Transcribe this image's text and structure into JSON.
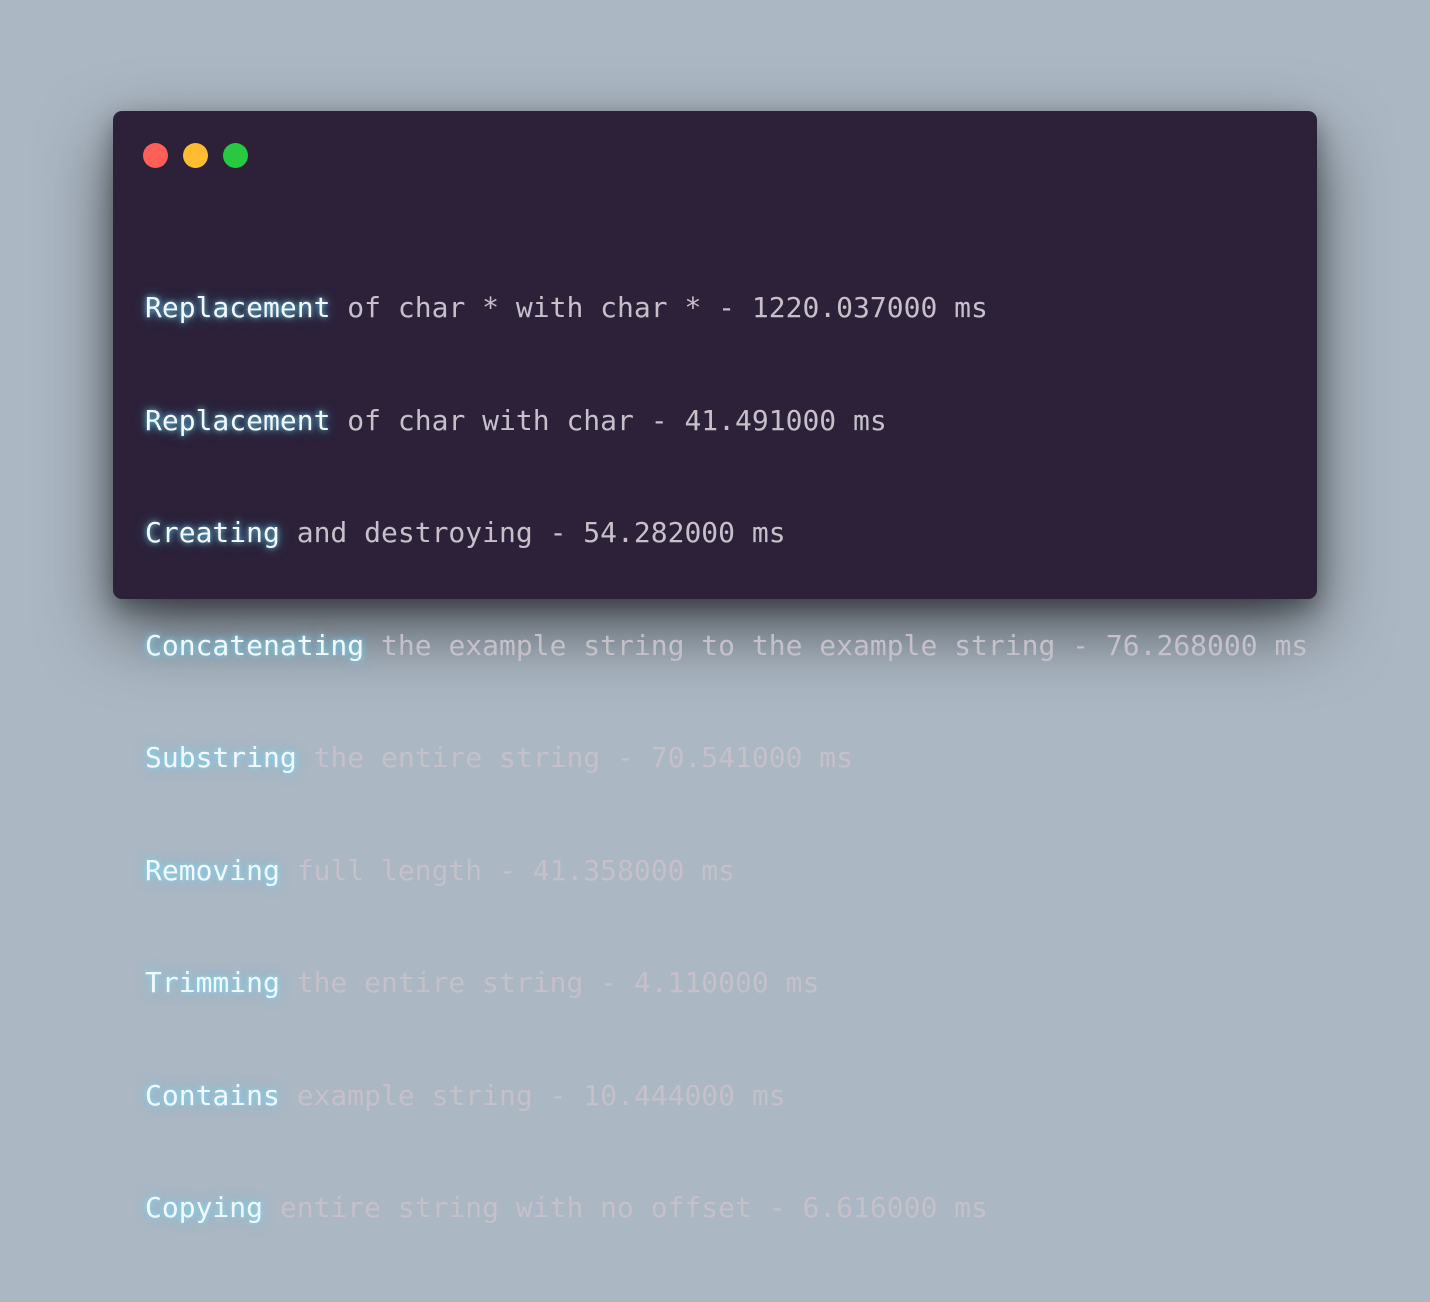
{
  "window": {
    "controls": [
      {
        "name": "close",
        "color": "#fe5f57"
      },
      {
        "name": "minimize",
        "color": "#febc2e"
      },
      {
        "name": "maximize",
        "color": "#28c840"
      }
    ]
  },
  "terminal": {
    "lines": [
      {
        "keyword": "Replacement",
        "rest": " of char * with char * - 1220.037000 ms"
      },
      {
        "keyword": "Replacement",
        "rest": " of char with char - 41.491000 ms"
      },
      {
        "keyword": "Creating",
        "rest": " and destroying - 54.282000 ms"
      },
      {
        "keyword": "Concatenating",
        "rest": " the example string to the example string - 76.268000 ms"
      },
      {
        "keyword": "Substring",
        "rest": " the entire string - 70.541000 ms"
      },
      {
        "keyword": "Removing",
        "rest": " full length - 41.358000 ms"
      },
      {
        "keyword": "Trimming",
        "rest": " the entire string - 4.110000 ms"
      },
      {
        "keyword": "Contains",
        "rest": " example string - 10.444000 ms"
      },
      {
        "keyword": "Copying",
        "rest": " entire string with no offset - 6.616000 ms"
      }
    ]
  }
}
